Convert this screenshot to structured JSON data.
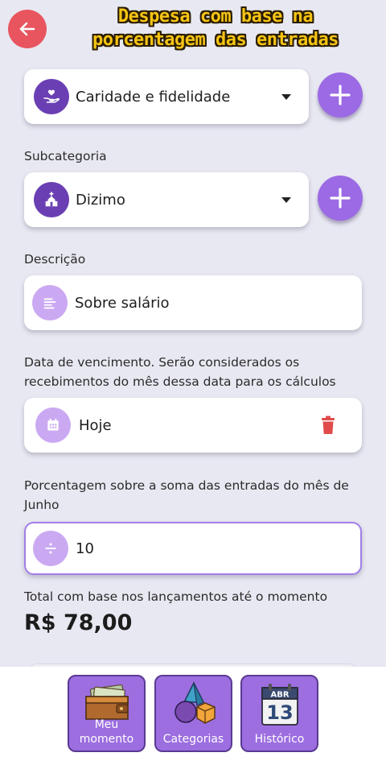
{
  "header": {
    "title_line1": "Despesa com base na",
    "title_line2": "porcentagem das entradas"
  },
  "category": {
    "value": "Caridade e fidelidade"
  },
  "subcategory": {
    "label": "Subcategoria",
    "value": "Dizimo"
  },
  "description": {
    "label": "Descrição",
    "value": "Sobre salário"
  },
  "due_date": {
    "label_line1": "Data de vencimento. Serão considerados os",
    "label_line2": "recebimentos do mês dessa data para os cálculos",
    "value": "Hoje"
  },
  "percentage": {
    "label_line1": "Porcentagem sobre a soma das entradas do mês de",
    "label_line2": "Junho",
    "value": "10"
  },
  "total": {
    "label": "Total com base nos lançamentos até o momento",
    "value": "R$ 78,00"
  },
  "bottom_nav": {
    "items": [
      {
        "label_line1": "Meu",
        "label_line2": "momento"
      },
      {
        "label_line1": "",
        "label_line2": "Categorias"
      },
      {
        "label_line1": "",
        "label_line2": "Histórico"
      }
    ],
    "calendar_month": "ABR",
    "calendar_day": "13"
  },
  "colors": {
    "accent": "#9b6ae4",
    "accent_dark": "#6a3fb3",
    "accent_light": "#cba9f2",
    "back_button": "#e8555f",
    "delete": "#e14b4b",
    "title": "#f6c415"
  }
}
